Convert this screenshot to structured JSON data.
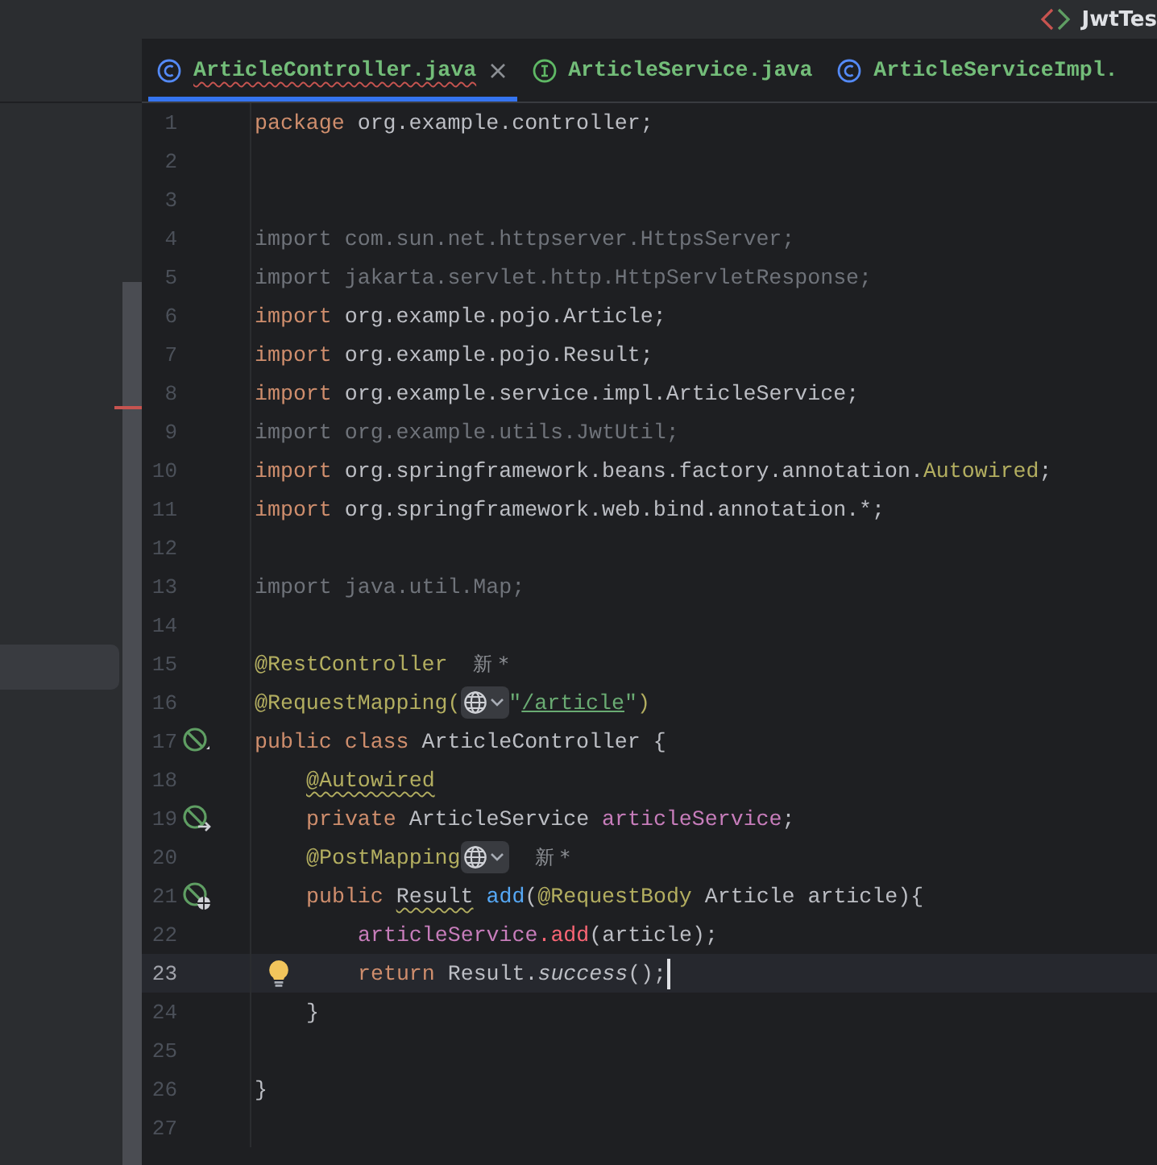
{
  "title_bar": {
    "title": "JwtTes"
  },
  "project_panel": {
    "items": [
      {
        "selected": true
      }
    ]
  },
  "tabs": [
    {
      "label": "ArticleController.java",
      "kind": "class",
      "selected": true,
      "squiggle": true
    },
    {
      "label": "ArticleService.java",
      "kind": "interface",
      "selected": false,
      "squiggle": false
    },
    {
      "label": "ArticleServiceImpl.",
      "kind": "class",
      "selected": false,
      "squiggle": false
    }
  ],
  "editor": {
    "lines": [
      {
        "number": "1",
        "current": false,
        "parts": [
          {
            "kind": "code",
            "tokens": [
              {
                "kind": "kw",
                "text": "package"
              },
              {
                "kind": "plain",
                "text": " org.example.controller;"
              }
            ]
          }
        ]
      },
      {
        "number": "2",
        "current": false
      },
      {
        "number": "3",
        "current": false
      },
      {
        "number": "4",
        "current": false,
        "parts": [
          {
            "kind": "code",
            "tokens": [
              {
                "kind": "dim",
                "text": "import com.sun.net.httpserver.HttpsServer;"
              }
            ]
          }
        ]
      },
      {
        "number": "5",
        "current": false,
        "parts": [
          {
            "kind": "code",
            "tokens": [
              {
                "kind": "dim",
                "text": "import jakarta.servlet.http.HttpServletResponse;"
              }
            ]
          }
        ]
      },
      {
        "number": "6",
        "current": false,
        "parts": [
          {
            "kind": "code",
            "tokens": [
              {
                "kind": "kw",
                "text": "import"
              },
              {
                "kind": "plain",
                "text": " org.example.pojo.Article;"
              }
            ]
          }
        ]
      },
      {
        "number": "7",
        "current": false,
        "parts": [
          {
            "kind": "code",
            "tokens": [
              {
                "kind": "kw",
                "text": "import"
              },
              {
                "kind": "plain",
                "text": " org.example.pojo.Result;"
              }
            ]
          }
        ]
      },
      {
        "number": "8",
        "current": false,
        "parts": [
          {
            "kind": "code",
            "tokens": [
              {
                "kind": "kw",
                "text": "import"
              },
              {
                "kind": "plain",
                "text": " org.example.service.impl.ArticleService;"
              }
            ]
          }
        ]
      },
      {
        "number": "9",
        "current": false,
        "parts": [
          {
            "kind": "code",
            "tokens": [
              {
                "kind": "dim",
                "text": "import org.example.utils.JwtUtil;"
              }
            ]
          }
        ]
      },
      {
        "number": "10",
        "current": false,
        "parts": [
          {
            "kind": "code",
            "tokens": [
              {
                "kind": "kw",
                "text": "import"
              },
              {
                "kind": "plain",
                "text": " org.springframework.beans.factory.annotation."
              },
              {
                "kind": "ann",
                "text": "Autowired"
              },
              {
                "kind": "plain",
                "text": ";"
              }
            ]
          }
        ]
      },
      {
        "number": "11",
        "current": false,
        "parts": [
          {
            "kind": "code",
            "tokens": [
              {
                "kind": "kw",
                "text": "import"
              },
              {
                "kind": "plain",
                "text": " org.springframework.web.bind.annotation.*;"
              }
            ]
          }
        ]
      },
      {
        "number": "12",
        "current": false
      },
      {
        "number": "13",
        "current": false,
        "parts": [
          {
            "kind": "code",
            "tokens": [
              {
                "kind": "dim",
                "text": "import java.util.Map;"
              }
            ]
          }
        ]
      },
      {
        "number": "14",
        "current": false
      },
      {
        "number": "15",
        "current": false,
        "parts": [
          {
            "kind": "code",
            "tokens": [
              {
                "kind": "ann",
                "text": "@RestController"
              }
            ]
          },
          {
            "kind": "hint",
            "text": "新 *"
          }
        ]
      },
      {
        "number": "16",
        "current": false,
        "parts": [
          {
            "kind": "code",
            "tokens": [
              {
                "kind": "ann",
                "text": "@RequestMapping("
              }
            ]
          },
          {
            "kind": "globe"
          },
          {
            "kind": "code",
            "tokens": [
              {
                "kind": "str",
                "text": "\""
              },
              {
                "kind": "link",
                "text": "/article"
              },
              {
                "kind": "str",
                "text": "\""
              },
              {
                "kind": "ann",
                "text": ")"
              }
            ]
          }
        ]
      },
      {
        "number": "17",
        "current": false,
        "gutter": {
          "kind": "bean"
        },
        "parts": [
          {
            "kind": "code",
            "tokens": [
              {
                "kind": "kw",
                "text": "public class "
              },
              {
                "kind": "plain",
                "text": "ArticleController {"
              }
            ]
          }
        ],
        "children": [
          {
            "number": "18",
            "current": false,
            "parts": [
              {
                "kind": "code",
                "tokens": [
                  {
                    "kind": "ann",
                    "text": "@Autowired",
                    "squiggle": true
                  }
                ]
              }
            ]
          },
          {
            "number": "19",
            "current": false,
            "gutter": {
              "kind": "bean-arrow"
            },
            "parts": [
              {
                "kind": "code",
                "tokens": [
                  {
                    "kind": "kw",
                    "text": "private "
                  },
                  {
                    "kind": "plain",
                    "text": "ArticleService "
                  },
                  {
                    "kind": "field",
                    "text": "articleService"
                  },
                  {
                    "kind": "plain",
                    "text": ";"
                  }
                ]
              }
            ]
          },
          {
            "number": "20",
            "current": false,
            "parts": [
              {
                "kind": "code",
                "tokens": [
                  {
                    "kind": "ann",
                    "text": "@PostMapping"
                  }
                ]
              },
              {
                "kind": "globe"
              },
              {
                "kind": "hint",
                "text": "新 *"
              }
            ]
          },
          {
            "number": "21",
            "current": false,
            "gutter": {
              "kind": "bean-web"
            },
            "parts": [
              {
                "kind": "code",
                "tokens": [
                  {
                    "kind": "kw",
                    "text": "public "
                  },
                  {
                    "kind": "plain",
                    "text": "Result",
                    "squiggle": true
                  },
                  {
                    "kind": "method",
                    "text": " add"
                  },
                  {
                    "kind": "plain",
                    "text": "("
                  },
                  {
                    "kind": "ann",
                    "text": "@RequestBody"
                  },
                  {
                    "kind": "plain",
                    "text": " Article article){"
                  }
                ]
              }
            ],
            "children": [
              {
                "number": "22",
                "current": false,
                "parts": [
                  {
                    "kind": "code",
                    "tokens": [
                      {
                        "kind": "field",
                        "text": "articleService"
                      },
                      {
                        "kind": "call",
                        "text": ".add"
                      },
                      {
                        "kind": "plain",
                        "text": "(article);"
                      }
                    ]
                  }
                ]
              },
              {
                "number": "23",
                "current": true,
                "intention": true,
                "parts": [
                  {
                    "kind": "code",
                    "tokens": [
                      {
                        "kind": "kw",
                        "text": "return "
                      },
                      {
                        "kind": "plain",
                        "text": "Result."
                      },
                      {
                        "kind": "italic",
                        "text": "success"
                      },
                      {
                        "kind": "plain",
                        "text": "();"
                      }
                    ]
                  }
                ]
              }
            ]
          },
          {
            "number": "24",
            "current": false,
            "parts": [
              {
                "kind": "code",
                "tokens": [
                  {
                    "kind": "plain",
                    "text": "}"
                  }
                ]
              }
            ]
          }
        ]
      },
      {
        "number": "25",
        "current": false
      },
      {
        "number": "26",
        "current": false,
        "parts": [
          {
            "kind": "code",
            "tokens": [
              {
                "kind": "plain",
                "text": "}"
              }
            ]
          }
        ]
      },
      {
        "number": "27",
        "current": false
      }
    ]
  }
}
